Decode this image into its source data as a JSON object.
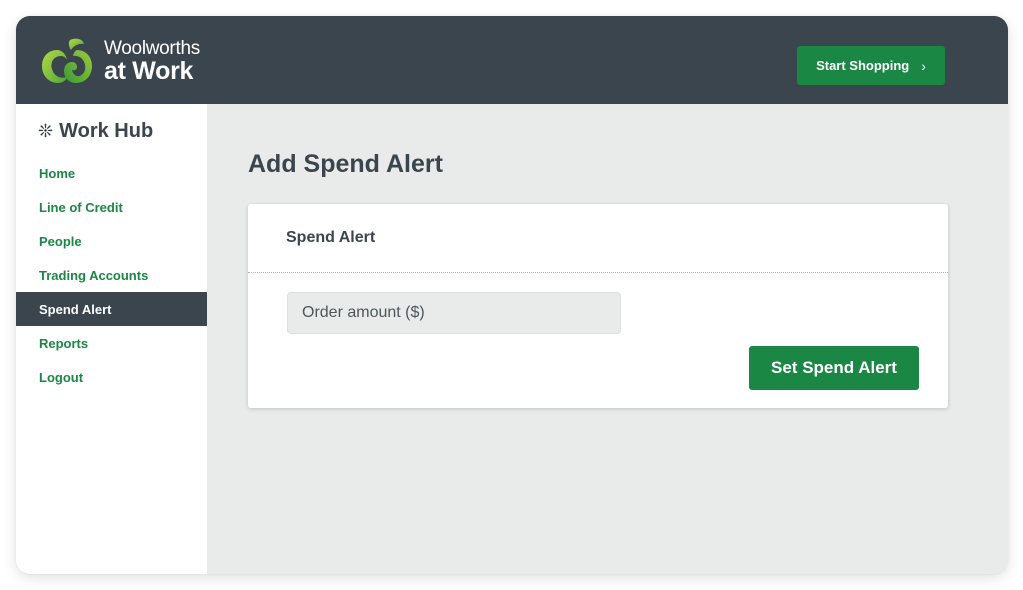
{
  "brand": {
    "line1": "Woolworths",
    "line2": "at Work",
    "logo_icon": "woolworths-apple-logo",
    "colors": {
      "primary_green": "#1a8744",
      "header_dark": "#3a454d",
      "background": "#e9ebea"
    }
  },
  "header": {
    "start_shopping_label": "Start Shopping",
    "start_shopping_icon": "chevron-right-icon",
    "chevron": "›"
  },
  "sidebar": {
    "title": "Work Hub",
    "title_icon": "snowflake-hub-icon",
    "title_icon_glyph": "❊",
    "items": [
      {
        "label": "Home",
        "active": false
      },
      {
        "label": "Line of Credit",
        "active": false
      },
      {
        "label": "People",
        "active": false
      },
      {
        "label": "Trading Accounts",
        "active": false
      },
      {
        "label": "Spend Alert",
        "active": true
      },
      {
        "label": "Reports",
        "active": false
      },
      {
        "label": "Logout",
        "active": false
      }
    ]
  },
  "main": {
    "page_title": "Add Spend Alert",
    "card": {
      "title": "Spend Alert",
      "order_amount": {
        "placeholder": "Order amount ($)",
        "value": ""
      },
      "submit_label": "Set Spend Alert"
    }
  }
}
